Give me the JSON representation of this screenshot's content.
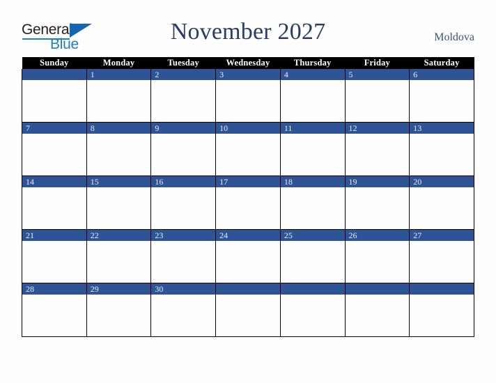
{
  "brand": {
    "word_dark": "General",
    "word_blue": "Blue",
    "triangle_color": "#1565b0",
    "blue_color": "#1f7fc4"
  },
  "header": {
    "title": "November 2027",
    "country": "Moldova",
    "title_color": "#2b3d63",
    "country_color": "#3c5180"
  },
  "calendar": {
    "band_color": "#2f5496",
    "header_bg": "#000000",
    "header_fg": "#ffffff",
    "weekday_headers": [
      "Sunday",
      "Monday",
      "Tuesday",
      "Wednesday",
      "Thursday",
      "Friday",
      "Saturday"
    ],
    "weeks": [
      [
        "",
        "1",
        "2",
        "3",
        "4",
        "5",
        "6"
      ],
      [
        "7",
        "8",
        "9",
        "10",
        "11",
        "12",
        "13"
      ],
      [
        "14",
        "15",
        "16",
        "17",
        "18",
        "19",
        "20"
      ],
      [
        "21",
        "22",
        "23",
        "24",
        "25",
        "26",
        "27"
      ],
      [
        "28",
        "29",
        "30",
        "",
        "",
        "",
        ""
      ]
    ]
  }
}
